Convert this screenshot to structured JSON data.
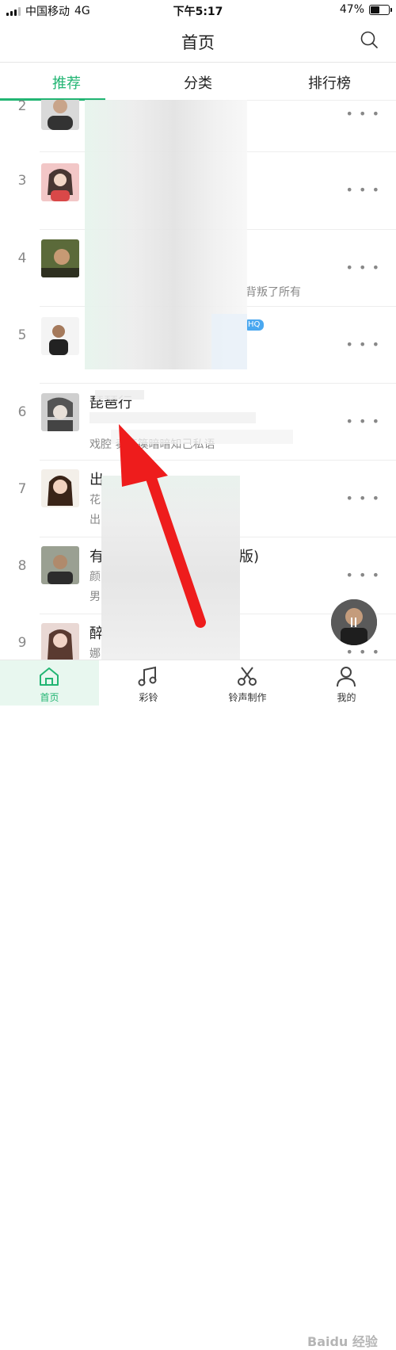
{
  "status": {
    "carrier": "中国移动",
    "network": "4G",
    "time": "下午5:17",
    "battery": "47%"
  },
  "header": {
    "title": "首页",
    "search_icon": "search-icon"
  },
  "tabs": [
    {
      "label": "推荐"
    },
    {
      "label": "分类"
    },
    {
      "label": "排行榜"
    }
  ],
  "accent": "#22b573",
  "rows": [
    {
      "rank": "2",
      "title": "",
      "sub": "",
      "desc": ""
    },
    {
      "rank": "3",
      "title": "",
      "sub": "",
      "desc": ""
    },
    {
      "rank": "4",
      "title": "",
      "sub": "",
      "desc": "背叛了所有"
    },
    {
      "rank": "5",
      "title": "",
      "sub": "",
      "desc": "",
      "badge": "HQ"
    },
    {
      "rank": "6",
      "title": "琵琶行",
      "sub": "",
      "desc": "戏腔 奏箜篌暗暗知己私语"
    },
    {
      "rank": "7",
      "title": "出",
      "sub": "花",
      "desc": "出"
    },
    {
      "rank": "8",
      "title": "有",
      "sub": "颜",
      "desc": "男",
      "tail": "版)"
    },
    {
      "rank": "9",
      "title": "醉",
      "sub": "娜",
      "desc": ""
    }
  ],
  "more_label": "• • •",
  "nav": [
    {
      "label": "首页"
    },
    {
      "label": "彩铃"
    },
    {
      "label": "铃声制作"
    },
    {
      "label": "我的"
    }
  ],
  "watermark": "Baidu 经验"
}
